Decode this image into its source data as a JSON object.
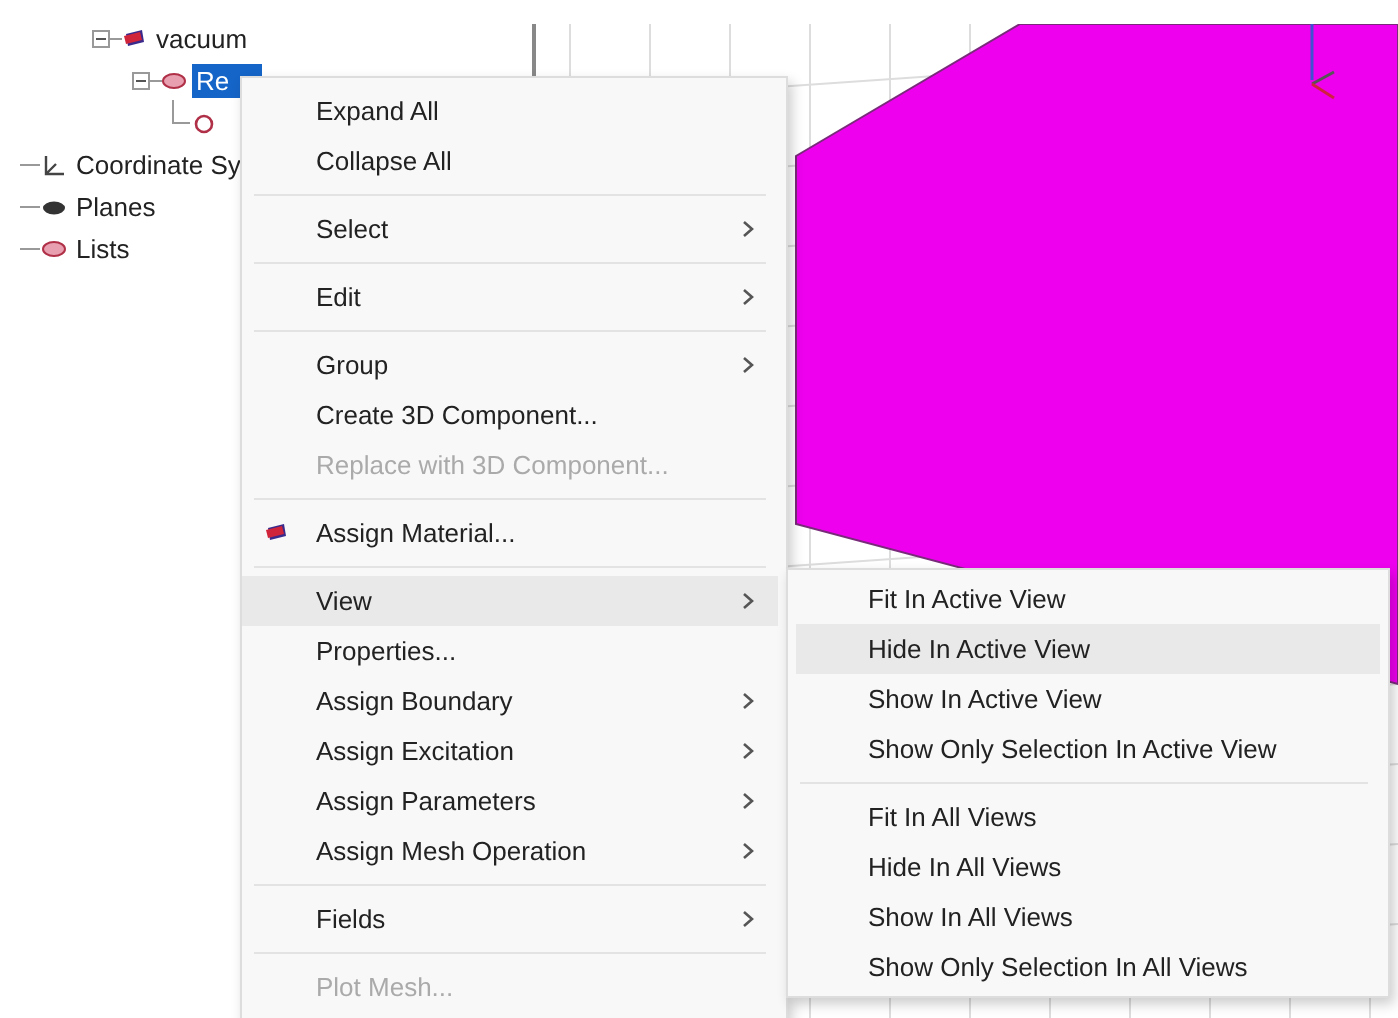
{
  "tree": {
    "branch": [
      {
        "label": "vacuum",
        "kind": "solid",
        "expanded": true,
        "selected": false,
        "children": [
          {
            "label": "Re",
            "kind": "region",
            "expanded": true,
            "selected": true,
            "children": [
              {
                "kind": "face"
              }
            ]
          }
        ]
      }
    ],
    "items": [
      {
        "label": "Coordinate Sy",
        "kind": "coords",
        "selected": false
      },
      {
        "label": "Planes",
        "kind": "planes",
        "selected": false
      },
      {
        "label": "Lists",
        "kind": "list",
        "selected": false
      }
    ]
  },
  "context_menu": [
    {
      "kind": "item",
      "label": "Expand All",
      "submenu": false,
      "disabled": false,
      "selected": false
    },
    {
      "kind": "item",
      "label": "Collapse All",
      "submenu": false,
      "disabled": false,
      "selected": false
    },
    {
      "kind": "separator"
    },
    {
      "kind": "item",
      "label": "Select",
      "submenu": true,
      "disabled": false,
      "selected": false
    },
    {
      "kind": "separator"
    },
    {
      "kind": "item",
      "label": "Edit",
      "submenu": true,
      "disabled": false,
      "selected": false
    },
    {
      "kind": "separator"
    },
    {
      "kind": "item",
      "label": "Group",
      "submenu": true,
      "disabled": false,
      "selected": false
    },
    {
      "kind": "item",
      "label": "Create 3D Component...",
      "submenu": false,
      "disabled": false,
      "selected": false
    },
    {
      "kind": "item",
      "label": "Replace with 3D Component...",
      "submenu": false,
      "disabled": true,
      "selected": false
    },
    {
      "kind": "separator"
    },
    {
      "kind": "item",
      "label": "Assign Material...",
      "submenu": false,
      "disabled": false,
      "selected": false,
      "icon": true
    },
    {
      "kind": "separator"
    },
    {
      "kind": "item",
      "label": "View",
      "submenu": true,
      "disabled": false,
      "selected": true
    },
    {
      "kind": "item",
      "label": "Properties...",
      "submenu": false,
      "disabled": false,
      "selected": false
    },
    {
      "kind": "item",
      "label": "Assign Boundary",
      "submenu": true,
      "disabled": false,
      "selected": false
    },
    {
      "kind": "item",
      "label": "Assign Excitation",
      "submenu": true,
      "disabled": false,
      "selected": false
    },
    {
      "kind": "item",
      "label": "Assign Parameters",
      "submenu": true,
      "disabled": false,
      "selected": false
    },
    {
      "kind": "item",
      "label": "Assign Mesh Operation",
      "submenu": true,
      "disabled": false,
      "selected": false
    },
    {
      "kind": "separator"
    },
    {
      "kind": "item",
      "label": "Fields",
      "submenu": true,
      "disabled": false,
      "selected": false
    },
    {
      "kind": "separator"
    },
    {
      "kind": "item",
      "label": "Plot Mesh...",
      "submenu": false,
      "disabled": true,
      "selected": false
    }
  ],
  "view_submenu": [
    {
      "kind": "item",
      "label": "Fit In Active View",
      "selected": false
    },
    {
      "kind": "item",
      "label": "Hide In Active View",
      "selected": true
    },
    {
      "kind": "item",
      "label": "Show In Active View",
      "selected": false
    },
    {
      "kind": "item",
      "label": "Show Only Selection In Active View",
      "selected": false
    },
    {
      "kind": "separator"
    },
    {
      "kind": "item",
      "label": "Fit In All Views",
      "selected": false
    },
    {
      "kind": "item",
      "label": "Hide In All Views",
      "selected": false
    },
    {
      "kind": "item",
      "label": "Show In All Views",
      "selected": false
    },
    {
      "kind": "item",
      "label": "Show Only Selection In All Views",
      "selected": false
    }
  ]
}
